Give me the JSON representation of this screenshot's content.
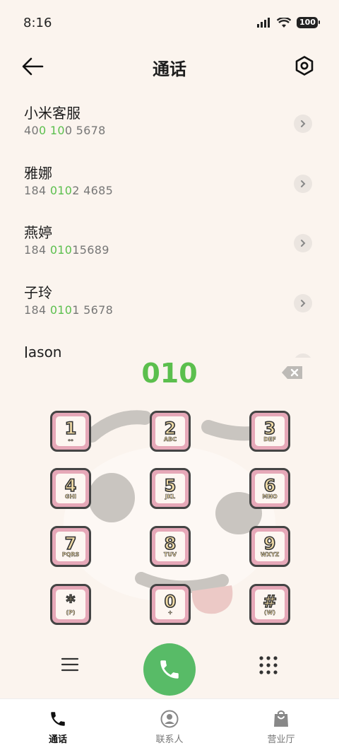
{
  "status_bar": {
    "time": "8:16",
    "battery": "100"
  },
  "header": {
    "title": "通话"
  },
  "contacts": [
    {
      "name": "小米客服",
      "number_parts": [
        {
          "text": "40",
          "hl": false
        },
        {
          "text": "0",
          "hl": true
        },
        {
          "text": " ",
          "hl": false
        },
        {
          "text": "10",
          "hl": true
        },
        {
          "text": "0 5678",
          "hl": false
        }
      ]
    },
    {
      "name": "雅娜",
      "number_parts": [
        {
          "text": "184 ",
          "hl": false
        },
        {
          "text": "010",
          "hl": true
        },
        {
          "text": "2 4685",
          "hl": false
        }
      ]
    },
    {
      "name": "燕婷",
      "number_parts": [
        {
          "text": "184 ",
          "hl": false
        },
        {
          "text": "010",
          "hl": true
        },
        {
          "text": "15689",
          "hl": false
        }
      ]
    },
    {
      "name": "子玲",
      "number_parts": [
        {
          "text": "184 ",
          "hl": false
        },
        {
          "text": "010",
          "hl": true
        },
        {
          "text": "1 5678",
          "hl": false
        }
      ]
    },
    {
      "name": "Jason",
      "number_parts": []
    }
  ],
  "dialer": {
    "input": "010"
  },
  "keys": [
    {
      "digit": "1",
      "letters": "ₒₒ"
    },
    {
      "digit": "2",
      "letters": "ABC"
    },
    {
      "digit": "3",
      "letters": "DEF"
    },
    {
      "digit": "4",
      "letters": "GHI"
    },
    {
      "digit": "5",
      "letters": "JKL"
    },
    {
      "digit": "6",
      "letters": "MNO"
    },
    {
      "digit": "7",
      "letters": "PQRS"
    },
    {
      "digit": "8",
      "letters": "TUV"
    },
    {
      "digit": "9",
      "letters": "WXYZ"
    },
    {
      "digit": "*",
      "letters": "(P)"
    },
    {
      "digit": "0",
      "letters": "+"
    },
    {
      "digit": "#",
      "letters": "(W)"
    }
  ],
  "tabs": [
    {
      "label": "通话",
      "icon": "phone-icon",
      "active": true
    },
    {
      "label": "联系人",
      "icon": "person-icon",
      "active": false
    },
    {
      "label": "营业厅",
      "icon": "shopping-bag-icon",
      "active": false
    }
  ],
  "colors": {
    "accent_green": "#5bbf4d",
    "call_button": "#58bb67",
    "key_border": "#e6a8b8",
    "background": "#fbf4ee"
  }
}
